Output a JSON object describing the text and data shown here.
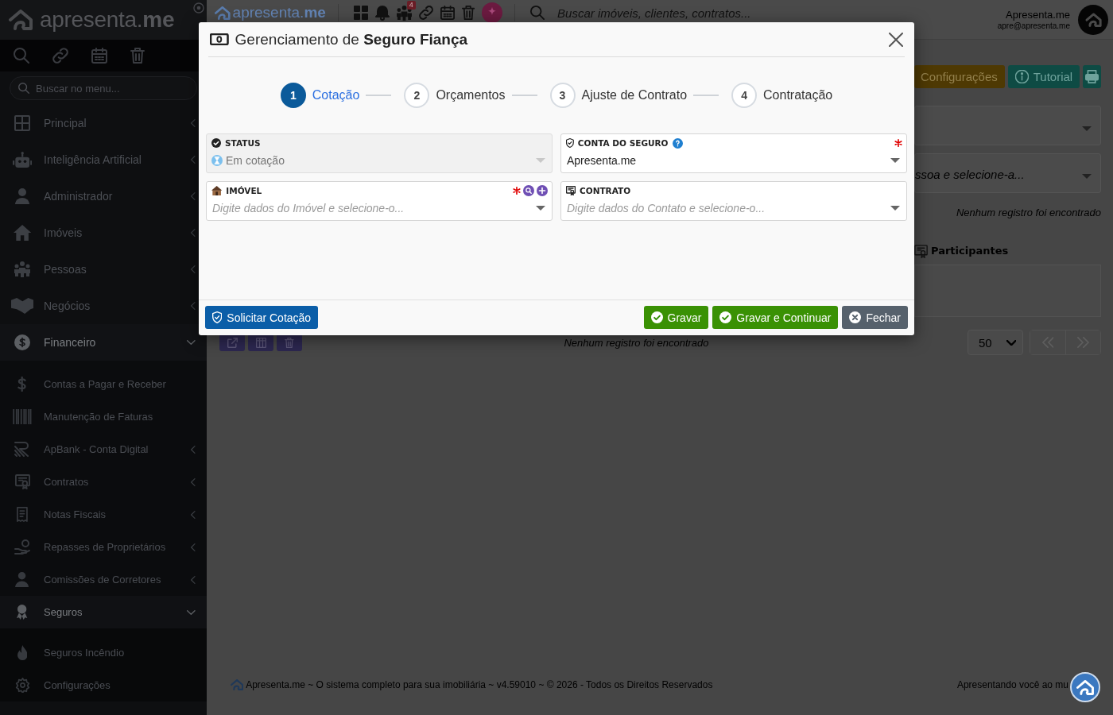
{
  "sidebar": {
    "logo": "apresenta.**me**",
    "search": {
      "placeholder": "Buscar no menu..."
    },
    "items": [
      {
        "label": "Principal",
        "expanded": false
      },
      {
        "label": "Inteligência Artificial",
        "expanded": false
      },
      {
        "label": "Administrador",
        "expanded": false
      },
      {
        "label": "Imóveis",
        "expanded": false
      },
      {
        "label": "Pessoas",
        "expanded": false
      },
      {
        "label": "Negócios",
        "expanded": false
      },
      {
        "label": "Financeiro",
        "expanded": true,
        "children": [
          {
            "label": "Contas a Pagar e Receber"
          },
          {
            "label": "Manutenção de Faturas"
          },
          {
            "label": "ApBank - Conta Digital",
            "expanded": false
          },
          {
            "label": "Contratos",
            "expanded": false
          },
          {
            "label": "Notas Fiscais",
            "expanded": false
          },
          {
            "label": "Repasses de Proprietários",
            "expanded": false
          },
          {
            "label": "Comissões de Corretores",
            "expanded": false
          },
          {
            "label": "Seguros",
            "expanded": true,
            "children": [
              {
                "label": "Seguros Incêndio"
              },
              {
                "label": "Configurações"
              }
            ]
          }
        ]
      }
    ]
  },
  "topbar": {
    "logo": "apresenta.**me**",
    "notification_count": "4",
    "search": {
      "placeholder": "Buscar imóveis, clientes, contratos..."
    },
    "user": {
      "name": "Apresenta.me",
      "email": "apre@apresenta.me"
    }
  },
  "page": {
    "buttons": [
      {
        "label": "Configurações",
        "kind": "warning"
      },
      {
        "label": "Tutorial",
        "kind": "info"
      },
      {
        "kind": "print"
      }
    ],
    "filters": [
      {
        "kind": "select"
      },
      {
        "kind": "select",
        "placeholder": "ssoa e selecione-a..."
      }
    ],
    "results_message": "Nenhum registro foi encontrado",
    "tab": {
      "label": "Participantes"
    },
    "table_toolbar": {
      "empty_message": "Nenhum registro foi encontrado",
      "page_size": "50"
    }
  },
  "footer": {
    "text": "Apresenta.me ~ O sistema completo para sua imobiliária ~ v4.59010 ~ © 2026 - Todos os Direitos Reservados",
    "tagline": "Apresentando você ao mu"
  },
  "modal": {
    "title": "Gerenciamento de **Seguro Fiança**",
    "steps": [
      {
        "number": "1",
        "label": "Cotação",
        "selected": true
      },
      {
        "number": "2",
        "label": "Orçamentos",
        "selected": false
      },
      {
        "number": "3",
        "label": "Ajuste de Contrato",
        "selected": false
      },
      {
        "number": "4",
        "label": "Contratação",
        "selected": false
      }
    ],
    "fields": [
      {
        "label": "STATUS",
        "value": "Em cotação",
        "required": false,
        "disabled": true
      },
      {
        "label": "CONTA DO SEGURO",
        "value": "Apresenta.me",
        "required": true,
        "disabled": false
      },
      {
        "label": "IMÓVEL",
        "placeholder": "Digite dados do Imóvel e selecione-o...",
        "required": true,
        "disabled": false
      },
      {
        "label": "CONTRATO",
        "placeholder": "Digite dados do Contato e selecione-o...",
        "required": false,
        "disabled": false
      }
    ],
    "footer": {
      "left_buttons": [
        {
          "label": "Solicitar Cotação",
          "kind": "primary"
        }
      ],
      "right_buttons": [
        {
          "label": "Gravar",
          "kind": "success"
        },
        {
          "label": "Gravar e Continuar",
          "kind": "success"
        },
        {
          "label": "Fechar",
          "kind": "secondary"
        }
      ]
    }
  }
}
